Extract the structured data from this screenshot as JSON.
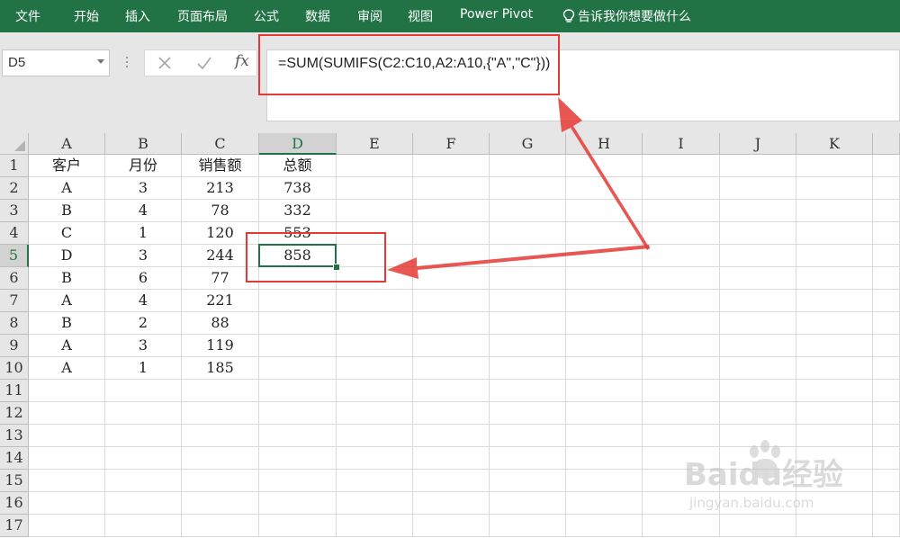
{
  "ribbon": {
    "tabs": [
      "文件",
      "开始",
      "插入",
      "页面布局",
      "公式",
      "数据",
      "审阅",
      "视图",
      "Power Pivot"
    ],
    "tell_me": "告诉我你想要做什么"
  },
  "formula_bar": {
    "name_box": "D5",
    "fx_label": "fx",
    "formula": "=SUM(SUMIFS(C2:C10,A2:A10,{\"A\",\"C\"}))"
  },
  "sheet": {
    "columns": [
      "A",
      "B",
      "C",
      "D",
      "E",
      "F",
      "G",
      "H",
      "I",
      "J",
      "K"
    ],
    "selected_column": "D",
    "selected_row": 5,
    "row_numbers": [
      1,
      2,
      3,
      4,
      5,
      6,
      7,
      8,
      9,
      10,
      11,
      12,
      13,
      14,
      15,
      16,
      17
    ],
    "rows": [
      [
        "客户",
        "月份",
        "销售额",
        "总额"
      ],
      [
        "A",
        "3",
        "213",
        "738"
      ],
      [
        "B",
        "4",
        "78",
        "332"
      ],
      [
        "C",
        "1",
        "120",
        "553"
      ],
      [
        "D",
        "3",
        "244",
        "858"
      ],
      [
        "B",
        "6",
        "77",
        ""
      ],
      [
        "A",
        "4",
        "221",
        ""
      ],
      [
        "B",
        "2",
        "88",
        ""
      ],
      [
        "A",
        "3",
        "119",
        ""
      ],
      [
        "A",
        "1",
        "185",
        ""
      ]
    ]
  },
  "annotation": {
    "color": "#e53935"
  },
  "watermark": {
    "brand": "Baidu经验",
    "url": "jingyan.baidu.com"
  }
}
